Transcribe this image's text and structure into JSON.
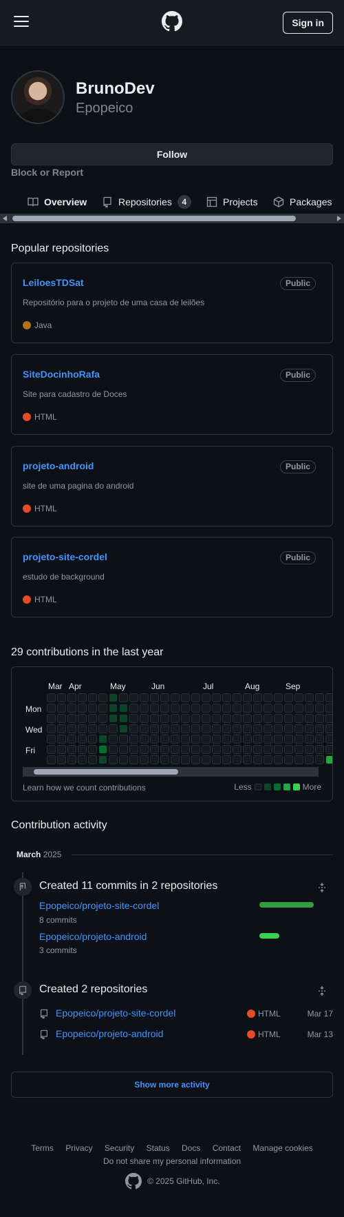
{
  "header": {
    "signin_label": "Sign in",
    "menu_icon": "hamburger-icon",
    "logo_icon": "github-logo-icon"
  },
  "profile": {
    "name": "BrunoDev",
    "login": "Epopeico",
    "follow_label": "Follow",
    "block_label": "Block or Report"
  },
  "tabs": [
    {
      "label": "Overview",
      "icon": "book-icon",
      "selected": true
    },
    {
      "label": "Repositories",
      "icon": "repo-icon",
      "count": "4"
    },
    {
      "label": "Projects",
      "icon": "table-icon"
    },
    {
      "label": "Packages",
      "icon": "package-icon"
    }
  ],
  "popular": {
    "title": "Popular repositories",
    "repos": [
      {
        "name": "LeiloesTDSat",
        "visibility": "Public",
        "description": "Repositório para o projeto de uma casa de leilões",
        "language": "Java",
        "lang_color": "#b07219"
      },
      {
        "name": "SiteDocinhoRafa",
        "visibility": "Public",
        "description": "Site para cadastro de Doces",
        "language": "HTML",
        "lang_color": "#e34c26"
      },
      {
        "name": "projeto-android",
        "visibility": "Public",
        "description": "site de uma pagina do android",
        "language": "HTML",
        "lang_color": "#e34c26"
      },
      {
        "name": "projeto-site-cordel",
        "visibility": "Public",
        "description": "estudo de background",
        "language": "HTML",
        "lang_color": "#e34c26"
      }
    ]
  },
  "contributions": {
    "title": "29 contributions in the last year",
    "months": [
      "Mar",
      "Apr",
      "May",
      "Jun",
      "Jul",
      "Aug",
      "Sep"
    ],
    "days": [
      "Mon",
      "Wed",
      "Fri"
    ],
    "learn_label": "Learn how we count contributions",
    "less_label": "Less",
    "more_label": "More",
    "colors": [
      "#161b22",
      "#0e4429",
      "#006d32",
      "#26a641",
      "#39d353"
    ],
    "active_cells": [
      {
        "week": 6,
        "day": 0,
        "level": 1
      },
      {
        "week": 6,
        "day": 1,
        "level": 1
      },
      {
        "week": 6,
        "day": 2,
        "level": 1
      },
      {
        "week": 7,
        "day": 2,
        "level": 1
      },
      {
        "week": 7,
        "day": 3,
        "level": 1
      },
      {
        "week": 5,
        "day": 4,
        "level": 1
      },
      {
        "week": 5,
        "day": 5,
        "level": 2
      },
      {
        "week": 5,
        "day": 6,
        "level": 1
      },
      {
        "week": 7,
        "day": 1,
        "level": 1
      },
      {
        "week": 27,
        "day": 6,
        "level": 3
      }
    ]
  },
  "activity": {
    "title": "Contribution activity",
    "month": "March",
    "year": "2025",
    "commits": {
      "title": "Created 11 commits in 2 repositories",
      "repos": [
        {
          "name": "Epopeico/projeto-site-cordel",
          "commits": "8 commits",
          "share": 0.73
        },
        {
          "name": "Epopeico/projeto-android",
          "commits": "3 commits",
          "share": 0.27
        }
      ]
    },
    "created": {
      "title": "Created 2 repositories",
      "repos": [
        {
          "name": "Epopeico/projeto-site-cordel",
          "language": "HTML",
          "date": "Mar 17"
        },
        {
          "name": "Epopeico/projeto-android",
          "language": "HTML",
          "date": "Mar 13"
        }
      ]
    },
    "show_more_label": "Show more activity"
  },
  "footer": {
    "links": [
      "Terms",
      "Privacy",
      "Security",
      "Status",
      "Docs",
      "Contact",
      "Manage cookies"
    ],
    "privacy_link": "Do not share my personal information",
    "copyright": "© 2025 GitHub, Inc."
  }
}
